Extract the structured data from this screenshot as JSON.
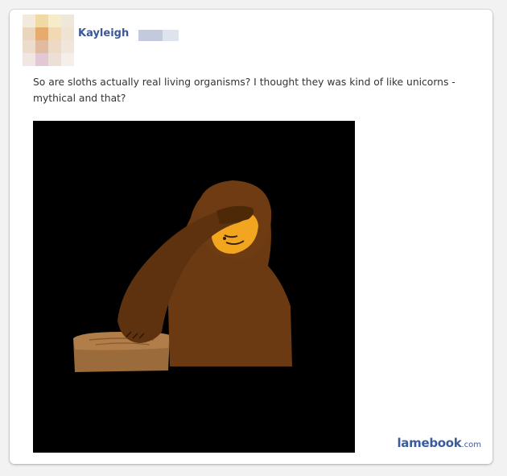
{
  "post": {
    "author": "Kayleigh",
    "text": "So are sloths actually real living organisms? I thought they was kind of like unicorns - mythical and that?",
    "image_subject": "sloth-facepalm-drawing"
  },
  "watermark": {
    "brand": "lamebook",
    "tld": ".com"
  },
  "colors": {
    "link": "#3b5998",
    "body_text": "#333333",
    "photo_bg": "#000000",
    "sloth_fur": "#6b3a12",
    "sloth_face": "#f5a623",
    "log": "#a0703c"
  }
}
